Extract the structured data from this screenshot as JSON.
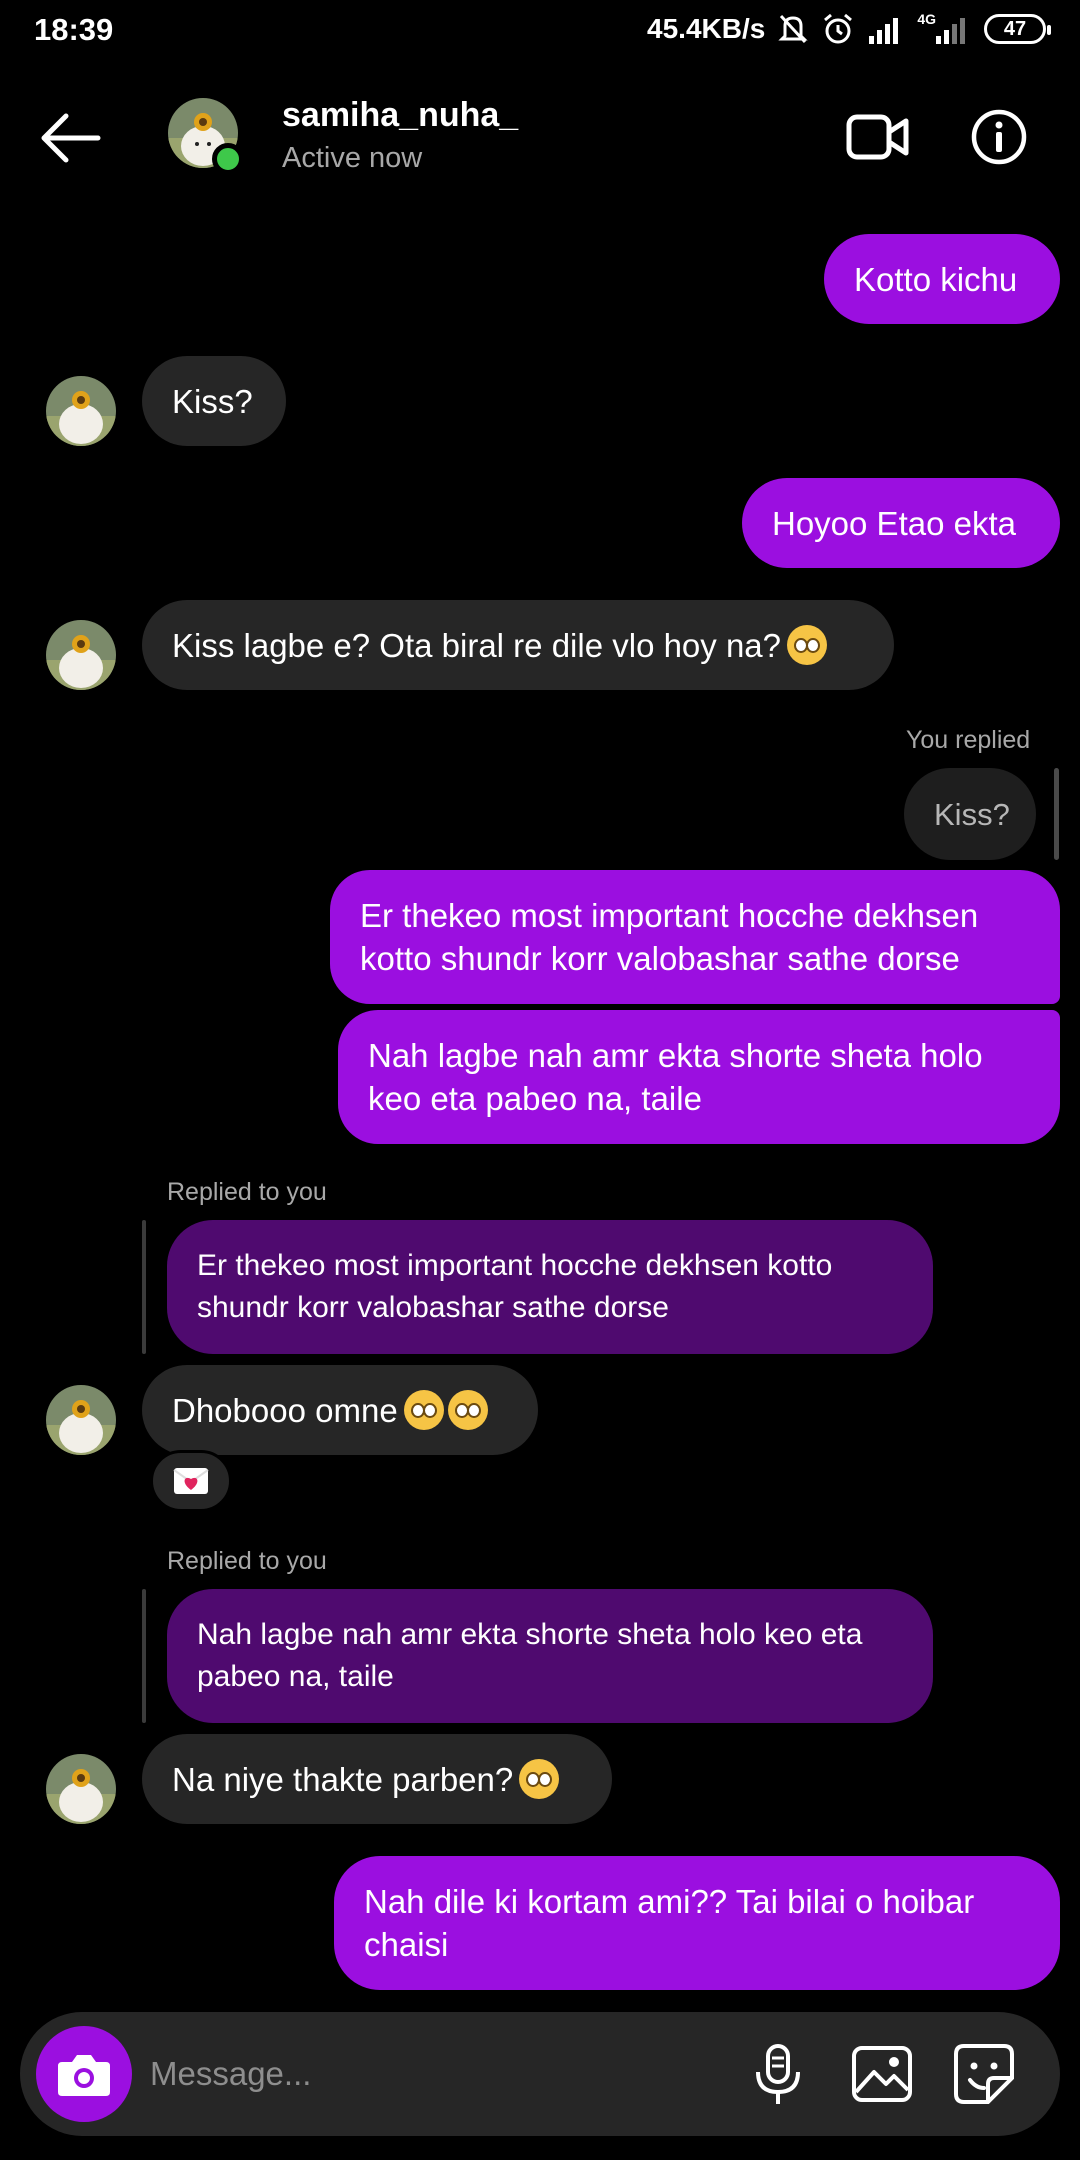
{
  "status_bar": {
    "time": "18:39",
    "speed": "45.4KB/s",
    "network": "4G",
    "battery": "47"
  },
  "header": {
    "username": "samiha_nuha_",
    "status": "Active now"
  },
  "messages": {
    "m1": "Kotto kichu",
    "m2": "Kiss?",
    "m3": "Hoyoo Etao ekta",
    "m4": "Kiss lagbe e? Ota biral re dile vlo hoy na?",
    "m5_label": "You replied",
    "m5_quote": "Kiss?",
    "m6": "Er thekeo most important hocche dekhsen kotto shundr korr valobashar sathe dorse",
    "m7": "Nah lagbe nah amr ekta shorte sheta holo keo eta pabeo na, taile",
    "m8_label": "Replied to you",
    "m8_quote": "Er thekeo most important hocche dekhsen kotto shundr korr valobashar sathe dorse",
    "m8": "Dhobooo omne",
    "m9_label": "Replied to you",
    "m9_quote": "Nah lagbe nah amr ekta shorte sheta holo keo eta pabeo na, taile",
    "m9": "Na niye thakte parben?",
    "m10": "Nah dile ki kortam ami?? Tai bilai o hoibar chaisi"
  },
  "composer": {
    "placeholder": "Message..."
  },
  "colors": {
    "outgoing": "#9b0fe0",
    "incoming": "#262626",
    "reply_quote": "#4f0a6f",
    "online": "#3ec84a"
  }
}
